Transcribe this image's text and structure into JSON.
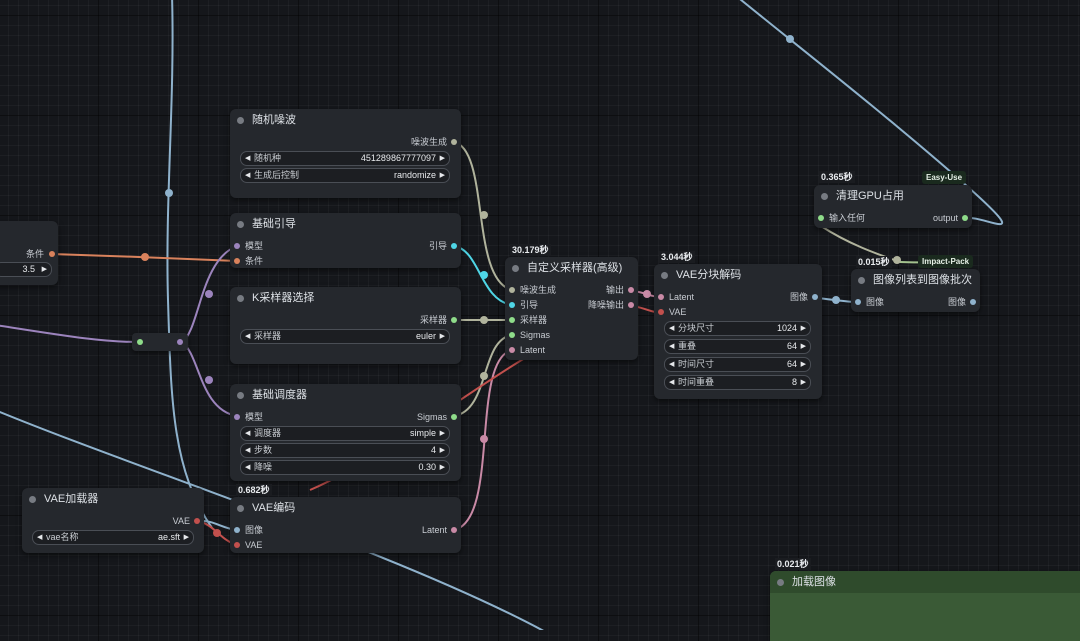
{
  "colors": {
    "canvas": "#15171b",
    "node_bg": "#25282d",
    "wire_blue": "#8fb2cc",
    "wire_gray": "#b0b39c",
    "wire_cyan": "#4fd6e6",
    "wire_orange": "#d9825c",
    "wire_purple": "#9c84bd",
    "wire_pink": "#c98aa6",
    "wire_red": "#c2504d",
    "wire_green": "#a3c28e",
    "load_image_bg": "#3a5a36"
  },
  "left_partial": {
    "cond_label": "条件",
    "value": "3.5"
  },
  "random_noise": {
    "title": "随机噪波",
    "out_noise": "噪波生成",
    "seed_label": "随机种",
    "seed_value": "451289867777097",
    "control_label": "生成后控制",
    "control_value": "randomize"
  },
  "basic_guider": {
    "title": "基础引导",
    "in_model": "模型",
    "in_cond": "条件",
    "out_guider": "引导"
  },
  "ksampler_select": {
    "title": "K采样器选择",
    "out_sampler": "采样器",
    "sampler_label": "采样器",
    "sampler_value": "euler"
  },
  "basic_scheduler": {
    "title": "基础调度器",
    "in_model": "模型",
    "out_sigmas": "Sigmas",
    "scheduler_label": "调度器",
    "scheduler_value": "simple",
    "steps_label": "步数",
    "steps_value": "4",
    "denoise_label": "降噪",
    "denoise_value": "0.30"
  },
  "vae_loader": {
    "title": "VAE加载器",
    "out_vae": "VAE",
    "vae_name_label": "vae名称",
    "vae_name_value": "ae.sft"
  },
  "vae_encode": {
    "timing": "0.682秒",
    "title": "VAE编码",
    "in_image": "图像",
    "in_vae": "VAE",
    "out_latent": "Latent"
  },
  "custom_sampler": {
    "timing": "30.179秒",
    "title": "自定义采样器(高级)",
    "in_noise": "噪波生成",
    "in_guider": "引导",
    "in_sampler": "采样器",
    "in_sigmas": "Sigmas",
    "in_latent": "Latent",
    "out_output": "输出",
    "out_denoised": "降噪输出"
  },
  "vae_tiled_decode": {
    "timing": "3.044秒",
    "title": "VAE分块解码",
    "in_latent": "Latent",
    "in_vae": "VAE",
    "out_image": "图像",
    "tile_size_label": "分块尺寸",
    "tile_size_value": "1024",
    "overlap_label": "重叠",
    "overlap_value": "64",
    "temporal_size_label": "时间尺寸",
    "temporal_size_value": "64",
    "temporal_overlap_label": "时间重叠",
    "temporal_overlap_value": "8"
  },
  "clean_gpu": {
    "timing": "0.365秒",
    "badge": "Easy-Use",
    "title": "清理GPU占用",
    "in_any": "输入任何",
    "out_output": "output"
  },
  "image_list_to_batch": {
    "timing": "0.015秒",
    "badge": "Impact-Pack",
    "title": "图像列表到图像批次",
    "in_image": "图像",
    "out_image": "图像"
  },
  "load_image": {
    "timing": "0.021秒",
    "title": "加载图像"
  }
}
